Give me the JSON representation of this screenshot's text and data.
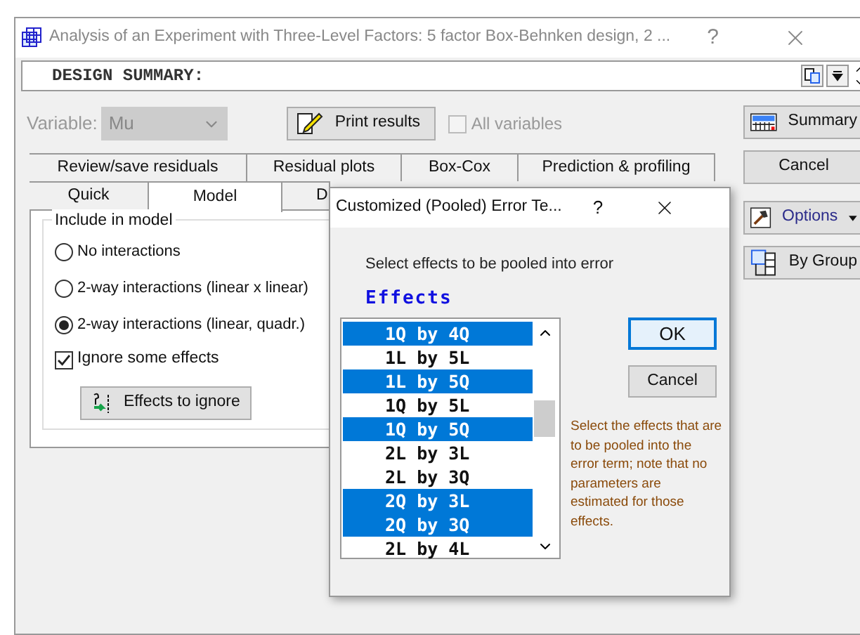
{
  "window": {
    "title": "Analysis of an Experiment with Three-Level Factors: 5 factor Box-Behnken design, 2 ...",
    "help": "?"
  },
  "summary_bar": {
    "text": "DESIGN SUMMARY:"
  },
  "variable": {
    "label": "Variable:",
    "value": "Mu",
    "disabled": true
  },
  "print_button": {
    "label": "Print results"
  },
  "all_variables": {
    "label": "All variables",
    "checked": false,
    "disabled": true
  },
  "tabs_back": [
    {
      "label": "Review/save residuals",
      "selected": false
    },
    {
      "label": "Residual plots",
      "selected": false
    },
    {
      "label": "Box-Cox",
      "selected": false
    },
    {
      "label": "Prediction & profiling",
      "selected": false
    }
  ],
  "tabs_front": [
    {
      "label": "Quick",
      "selected": false
    },
    {
      "label": "Model",
      "selected": true
    },
    {
      "label": "D",
      "selected": false
    }
  ],
  "group": {
    "title": "Include in model",
    "options": [
      {
        "label": "No interactions",
        "selected": false
      },
      {
        "label": "2-way interactions (linear x linear)",
        "selected": false
      },
      {
        "label": "2-way interactions (linear, quadr.)",
        "selected": true
      }
    ],
    "ignore": {
      "label": "Ignore some effects",
      "checked": true
    },
    "effects_button": "Effects to ignore"
  },
  "side_buttons": [
    {
      "label": "Summary",
      "kind": "summary"
    },
    {
      "label": "Cancel",
      "kind": "plain"
    },
    {
      "label": "Options",
      "kind": "options"
    },
    {
      "label": "By Group",
      "kind": "group"
    }
  ],
  "dialog": {
    "title": "Customized (Pooled) Error Te...",
    "help": "?",
    "prompt": "Select effects to be pooled into error",
    "header": "Effects",
    "items": [
      {
        "label": "1Q by 4Q",
        "selected": true
      },
      {
        "label": "1L by 5L",
        "selected": false
      },
      {
        "label": "1L by 5Q",
        "selected": true
      },
      {
        "label": "1Q by 5L",
        "selected": false
      },
      {
        "label": "1Q by 5Q",
        "selected": true
      },
      {
        "label": "2L by 3L",
        "selected": false
      },
      {
        "label": "2L by 3Q",
        "selected": false
      },
      {
        "label": "2Q by 3L",
        "selected": true
      },
      {
        "label": "2Q by 3Q",
        "selected": true
      },
      {
        "label": "2L by 4L",
        "selected": false
      }
    ],
    "ok": "OK",
    "cancel": "Cancel",
    "note": "Select the effects that are to be pooled into the error term; note that no parameters are estimated for those effects."
  }
}
